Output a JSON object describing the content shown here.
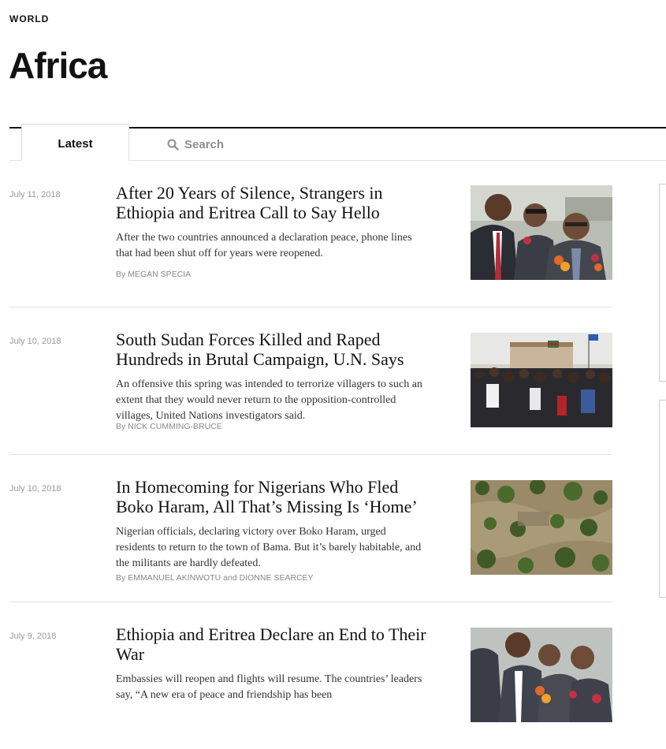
{
  "section": {
    "kicker": "WORLD",
    "title": "Africa"
  },
  "tabs": {
    "latest_label": "Latest",
    "search_label": "Search"
  },
  "stories": [
    {
      "date": "July 11, 2018",
      "headline": "After 20 Years of Silence, Strangers in Ethiopia and Eritrea Call to Say Hello",
      "summary": "After the two countries announced a declaration peace, phone lines that had been shut off for years were reopened.",
      "byline_prefix": "By",
      "authors": "MEGAN SPECIA",
      "image": "photo of two smiling officials in suits with flower garlands"
    },
    {
      "date": "July 10, 2018",
      "headline": "South Sudan Forces Killed and Raped Hundreds in Brutal Campaign, U.N. Says",
      "summary": "An offensive this spring was intended to terrorize villagers to such an extent that they would never return to the opposition-controlled villages, United Nations investigators said.",
      "byline_prefix": "By",
      "authors": "NICK CUMMING-BRUCE",
      "image": "photo of a large crowd outside a building with flags"
    },
    {
      "date": "July 10, 2018",
      "headline": "In Homecoming for Nigerians Who Fled Boko Haram, All That’s Missing Is ‘Home’",
      "summary": "Nigerian officials, declaring victory over Boko Haram, urged residents to return to the town of Bama. But it’s barely habitable, and the militants are hardly defeated.",
      "byline_prefix": "By",
      "authors": "EMMANUEL AKINWOTU",
      "byline_and": "and",
      "authors2": "DIONNE SEARCEY",
      "image": "aerial photo of a town among green trees"
    },
    {
      "date": "July 9, 2018",
      "headline": "Ethiopia and Eritrea Declare an End to Their War",
      "summary": "Embassies will reopen and flights will resume. The countries’ leaders say, “A new era of peace and friendship has been",
      "image": "photo of officials in suits with flower garlands"
    }
  ],
  "colors": {
    "text": "#121212",
    "muted": "#999999",
    "rule": "#e2e2e2",
    "search_muted": "#8e8e8e"
  },
  "icons": [
    "search-icon"
  ]
}
